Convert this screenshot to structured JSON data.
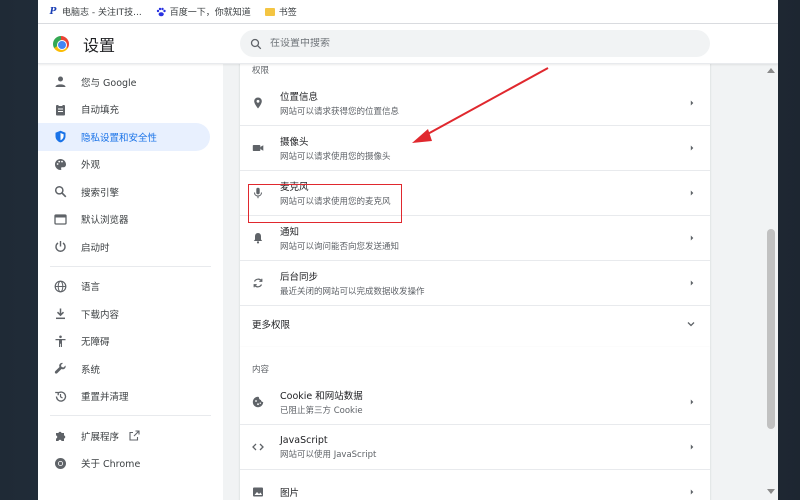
{
  "bookmarks": [
    {
      "label": "电脑志 - 关注IT技...",
      "icon": "pinterest-icon"
    },
    {
      "label": "百度一下，你就知道",
      "icon": "baidu-paw-icon"
    },
    {
      "label": "书签",
      "icon": "folder-icon"
    }
  ],
  "header": {
    "title": "设置",
    "search_placeholder": "在设置中搜索"
  },
  "sidebar": {
    "items": [
      {
        "label": "您与 Google"
      },
      {
        "label": "自动填充"
      },
      {
        "label": "隐私设置和安全性"
      },
      {
        "label": "外观"
      },
      {
        "label": "搜索引擎"
      },
      {
        "label": "默认浏览器"
      },
      {
        "label": "启动时"
      },
      {
        "label": "语言"
      },
      {
        "label": "下载内容"
      },
      {
        "label": "无障碍"
      },
      {
        "label": "系统"
      },
      {
        "label": "重置并清理"
      },
      {
        "label": "扩展程序"
      },
      {
        "label": "关于 Chrome"
      }
    ],
    "active_index": 2
  },
  "permissions": {
    "section_label": "权限",
    "rows": [
      {
        "title": "位置信息",
        "subtitle": "网站可以请求获得您的位置信息"
      },
      {
        "title": "摄像头",
        "subtitle": "网站可以请求使用您的摄像头"
      },
      {
        "title": "麦克风",
        "subtitle": "网站可以请求使用您的麦克风"
      },
      {
        "title": "通知",
        "subtitle": "网站可以询问能否向您发送通知"
      },
      {
        "title": "后台同步",
        "subtitle": "最近关闭的网站可以完成数据收发操作"
      }
    ],
    "more_label": "更多权限"
  },
  "content_section": {
    "section_label": "内容",
    "rows": [
      {
        "title": "Cookie 和网站数据",
        "subtitle": "已阻止第三方 Cookie"
      },
      {
        "title": "JavaScript",
        "subtitle": "网站可以使用 JavaScript"
      },
      {
        "title": "图片",
        "subtitle": ""
      }
    ]
  },
  "colors": {
    "accent": "#1a73e8",
    "active_bg": "#e8f0fe",
    "annotation": "#e0282e"
  }
}
